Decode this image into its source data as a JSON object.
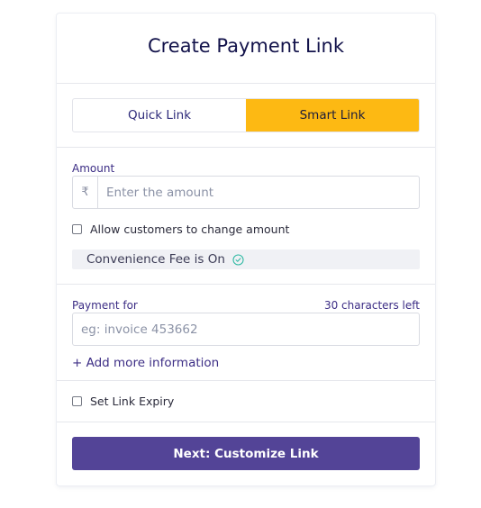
{
  "header": {
    "title": "Create Payment Link"
  },
  "link_type": {
    "options": [
      "Quick Link",
      "Smart Link"
    ],
    "selected": "Smart Link"
  },
  "amount": {
    "label": "Amount",
    "currency_symbol": "₹",
    "placeholder": "Enter the amount",
    "value": "",
    "allow_change_label": "Allow customers to change amount",
    "allow_change_checked": false,
    "convenience_fee_text": "Convenience Fee is On"
  },
  "payment_for": {
    "label": "Payment for",
    "counter": "30 characters left",
    "placeholder": "eg: invoice 453662",
    "value": ""
  },
  "add_more_label": "+ Add more information",
  "expiry": {
    "label": "Set Link Expiry",
    "checked": false
  },
  "next_button_label": "Next: Customize Link",
  "colors": {
    "accent": "#534497",
    "selected_tab": "#fdb913",
    "success": "#2fb9a3"
  },
  "icons": {
    "fee_status": "check-circle-icon"
  }
}
